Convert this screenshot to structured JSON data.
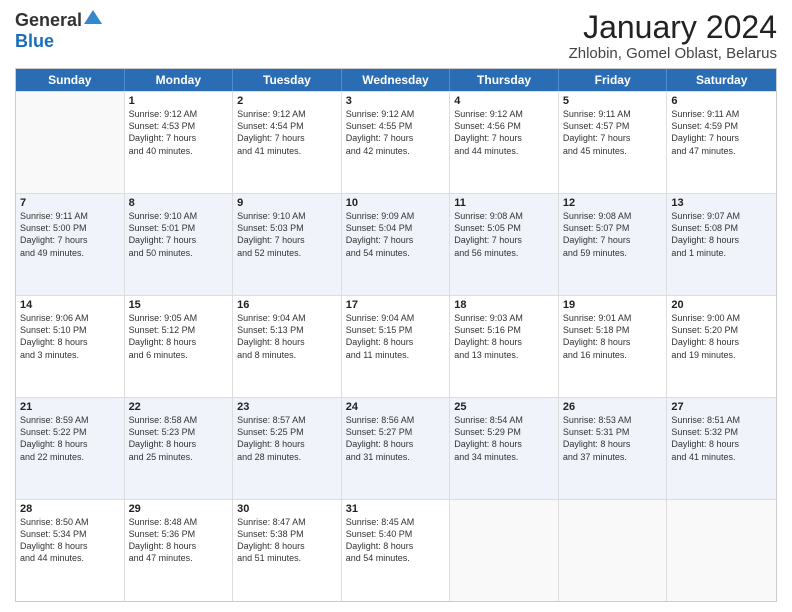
{
  "header": {
    "logo_general": "General",
    "logo_blue": "Blue",
    "title": "January 2024",
    "location": "Zhlobin, Gomel Oblast, Belarus"
  },
  "days_of_week": [
    "Sunday",
    "Monday",
    "Tuesday",
    "Wednesday",
    "Thursday",
    "Friday",
    "Saturday"
  ],
  "weeks": [
    [
      {
        "day": "",
        "lines": []
      },
      {
        "day": "1",
        "lines": [
          "Sunrise: 9:12 AM",
          "Sunset: 4:53 PM",
          "Daylight: 7 hours",
          "and 40 minutes."
        ]
      },
      {
        "day": "2",
        "lines": [
          "Sunrise: 9:12 AM",
          "Sunset: 4:54 PM",
          "Daylight: 7 hours",
          "and 41 minutes."
        ]
      },
      {
        "day": "3",
        "lines": [
          "Sunrise: 9:12 AM",
          "Sunset: 4:55 PM",
          "Daylight: 7 hours",
          "and 42 minutes."
        ]
      },
      {
        "day": "4",
        "lines": [
          "Sunrise: 9:12 AM",
          "Sunset: 4:56 PM",
          "Daylight: 7 hours",
          "and 44 minutes."
        ]
      },
      {
        "day": "5",
        "lines": [
          "Sunrise: 9:11 AM",
          "Sunset: 4:57 PM",
          "Daylight: 7 hours",
          "and 45 minutes."
        ]
      },
      {
        "day": "6",
        "lines": [
          "Sunrise: 9:11 AM",
          "Sunset: 4:59 PM",
          "Daylight: 7 hours",
          "and 47 minutes."
        ]
      }
    ],
    [
      {
        "day": "7",
        "lines": [
          "Sunrise: 9:11 AM",
          "Sunset: 5:00 PM",
          "Daylight: 7 hours",
          "and 49 minutes."
        ]
      },
      {
        "day": "8",
        "lines": [
          "Sunrise: 9:10 AM",
          "Sunset: 5:01 PM",
          "Daylight: 7 hours",
          "and 50 minutes."
        ]
      },
      {
        "day": "9",
        "lines": [
          "Sunrise: 9:10 AM",
          "Sunset: 5:03 PM",
          "Daylight: 7 hours",
          "and 52 minutes."
        ]
      },
      {
        "day": "10",
        "lines": [
          "Sunrise: 9:09 AM",
          "Sunset: 5:04 PM",
          "Daylight: 7 hours",
          "and 54 minutes."
        ]
      },
      {
        "day": "11",
        "lines": [
          "Sunrise: 9:08 AM",
          "Sunset: 5:05 PM",
          "Daylight: 7 hours",
          "and 56 minutes."
        ]
      },
      {
        "day": "12",
        "lines": [
          "Sunrise: 9:08 AM",
          "Sunset: 5:07 PM",
          "Daylight: 7 hours",
          "and 59 minutes."
        ]
      },
      {
        "day": "13",
        "lines": [
          "Sunrise: 9:07 AM",
          "Sunset: 5:08 PM",
          "Daylight: 8 hours",
          "and 1 minute."
        ]
      }
    ],
    [
      {
        "day": "14",
        "lines": [
          "Sunrise: 9:06 AM",
          "Sunset: 5:10 PM",
          "Daylight: 8 hours",
          "and 3 minutes."
        ]
      },
      {
        "day": "15",
        "lines": [
          "Sunrise: 9:05 AM",
          "Sunset: 5:12 PM",
          "Daylight: 8 hours",
          "and 6 minutes."
        ]
      },
      {
        "day": "16",
        "lines": [
          "Sunrise: 9:04 AM",
          "Sunset: 5:13 PM",
          "Daylight: 8 hours",
          "and 8 minutes."
        ]
      },
      {
        "day": "17",
        "lines": [
          "Sunrise: 9:04 AM",
          "Sunset: 5:15 PM",
          "Daylight: 8 hours",
          "and 11 minutes."
        ]
      },
      {
        "day": "18",
        "lines": [
          "Sunrise: 9:03 AM",
          "Sunset: 5:16 PM",
          "Daylight: 8 hours",
          "and 13 minutes."
        ]
      },
      {
        "day": "19",
        "lines": [
          "Sunrise: 9:01 AM",
          "Sunset: 5:18 PM",
          "Daylight: 8 hours",
          "and 16 minutes."
        ]
      },
      {
        "day": "20",
        "lines": [
          "Sunrise: 9:00 AM",
          "Sunset: 5:20 PM",
          "Daylight: 8 hours",
          "and 19 minutes."
        ]
      }
    ],
    [
      {
        "day": "21",
        "lines": [
          "Sunrise: 8:59 AM",
          "Sunset: 5:22 PM",
          "Daylight: 8 hours",
          "and 22 minutes."
        ]
      },
      {
        "day": "22",
        "lines": [
          "Sunrise: 8:58 AM",
          "Sunset: 5:23 PM",
          "Daylight: 8 hours",
          "and 25 minutes."
        ]
      },
      {
        "day": "23",
        "lines": [
          "Sunrise: 8:57 AM",
          "Sunset: 5:25 PM",
          "Daylight: 8 hours",
          "and 28 minutes."
        ]
      },
      {
        "day": "24",
        "lines": [
          "Sunrise: 8:56 AM",
          "Sunset: 5:27 PM",
          "Daylight: 8 hours",
          "and 31 minutes."
        ]
      },
      {
        "day": "25",
        "lines": [
          "Sunrise: 8:54 AM",
          "Sunset: 5:29 PM",
          "Daylight: 8 hours",
          "and 34 minutes."
        ]
      },
      {
        "day": "26",
        "lines": [
          "Sunrise: 8:53 AM",
          "Sunset: 5:31 PM",
          "Daylight: 8 hours",
          "and 37 minutes."
        ]
      },
      {
        "day": "27",
        "lines": [
          "Sunrise: 8:51 AM",
          "Sunset: 5:32 PM",
          "Daylight: 8 hours",
          "and 41 minutes."
        ]
      }
    ],
    [
      {
        "day": "28",
        "lines": [
          "Sunrise: 8:50 AM",
          "Sunset: 5:34 PM",
          "Daylight: 8 hours",
          "and 44 minutes."
        ]
      },
      {
        "day": "29",
        "lines": [
          "Sunrise: 8:48 AM",
          "Sunset: 5:36 PM",
          "Daylight: 8 hours",
          "and 47 minutes."
        ]
      },
      {
        "day": "30",
        "lines": [
          "Sunrise: 8:47 AM",
          "Sunset: 5:38 PM",
          "Daylight: 8 hours",
          "and 51 minutes."
        ]
      },
      {
        "day": "31",
        "lines": [
          "Sunrise: 8:45 AM",
          "Sunset: 5:40 PM",
          "Daylight: 8 hours",
          "and 54 minutes."
        ]
      },
      {
        "day": "",
        "lines": []
      },
      {
        "day": "",
        "lines": []
      },
      {
        "day": "",
        "lines": []
      }
    ]
  ]
}
